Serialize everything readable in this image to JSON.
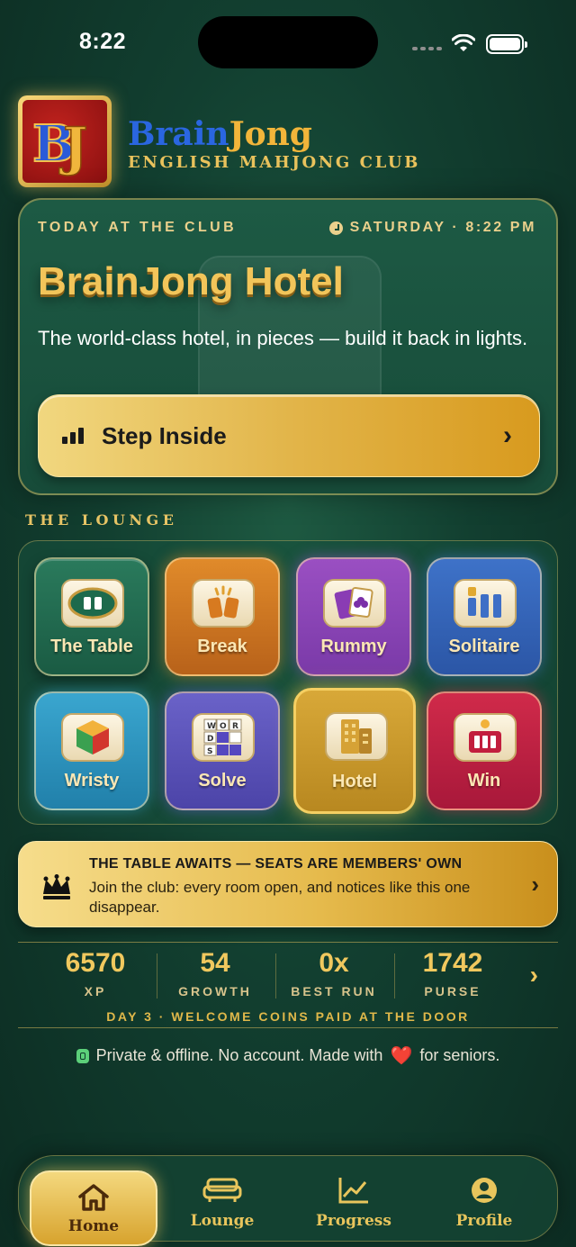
{
  "status_bar": {
    "time": "8:22"
  },
  "header": {
    "brand_part1": "Brain",
    "brand_part2": "Jong",
    "tagline": "ENGLISH MAHJONG CLUB",
    "logo_letters": "BJ"
  },
  "hero": {
    "kicker": "TODAY AT THE CLUB",
    "when": "SATURDAY · 8:22 PM",
    "title": "BrainJong Hotel",
    "description": "The world-class hotel, in pieces — build it back in lights.",
    "cta_label": "Step Inside",
    "cta_chevron": "›"
  },
  "lounge": {
    "label": "THE LOUNGE",
    "tiles": [
      {
        "name": "The Table",
        "icon": "table-icon"
      },
      {
        "name": "Break",
        "icon": "break-icon"
      },
      {
        "name": "Rummy",
        "icon": "cards-icon"
      },
      {
        "name": "Solitaire",
        "icon": "columns-icon"
      },
      {
        "name": "Wristy",
        "icon": "cube-icon"
      },
      {
        "name": "Solve",
        "icon": "word-grid-icon"
      },
      {
        "name": "Hotel",
        "icon": "hotel-icon"
      },
      {
        "name": "Win",
        "icon": "win-icon"
      }
    ],
    "word_grid": [
      "W",
      "O",
      "R",
      "D",
      "",
      "",
      "S",
      "",
      ""
    ]
  },
  "notice": {
    "headline": "THE TABLE AWAITS — SEATS ARE MEMBERS' OWN",
    "body": "Join the club: every room open, and notices like this one disappear.",
    "chevron": "›"
  },
  "stats": {
    "items": [
      {
        "value": "6570",
        "label": "XP"
      },
      {
        "value": "54",
        "label": "GROWTH"
      },
      {
        "value": "0x",
        "label": "BEST RUN"
      },
      {
        "value": "1742",
        "label": "PURSE"
      }
    ],
    "chevron": "›",
    "day_line": "DAY 3 · WELCOME COINS PAID AT THE DOOR"
  },
  "privacy": {
    "text_before": "Private & offline. No account. Made with",
    "heart": "❤️",
    "text_after": "for seniors."
  },
  "tabbar": {
    "tabs": [
      {
        "label": "Home",
        "icon": "home-icon",
        "active": true
      },
      {
        "label": "Lounge",
        "icon": "sofa-icon",
        "active": false
      },
      {
        "label": "Progress",
        "icon": "chart-icon",
        "active": false
      },
      {
        "label": "Profile",
        "icon": "person-icon",
        "active": false
      }
    ]
  },
  "colors": {
    "background": "#123f30",
    "gold": "#f0c85e",
    "brand_blue": "#2a66e0",
    "brand_gold": "#f2b53a"
  }
}
